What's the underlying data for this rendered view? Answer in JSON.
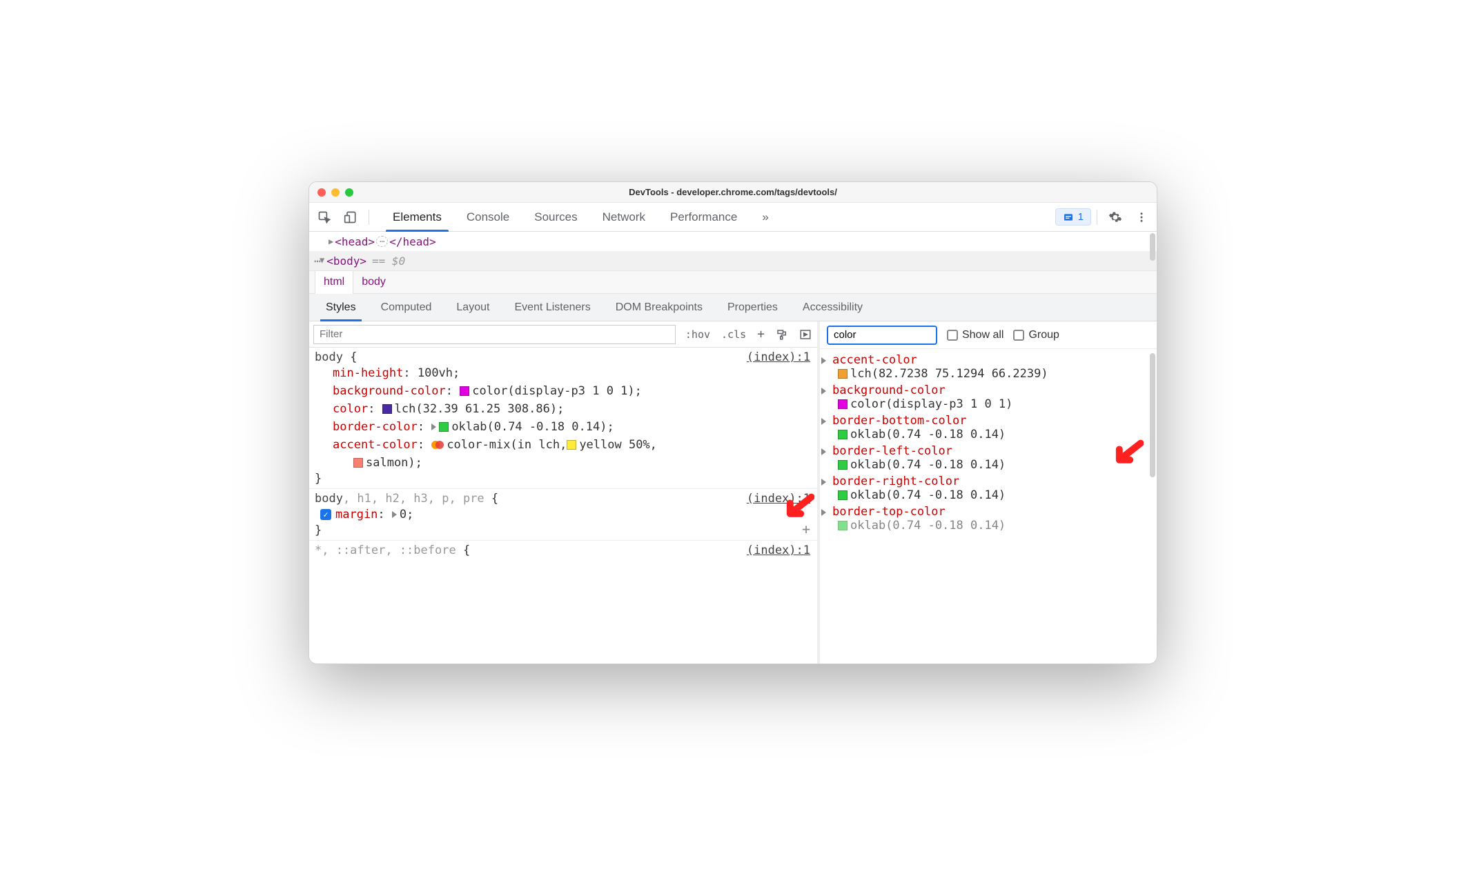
{
  "window": {
    "title": "DevTools - developer.chrome.com/tags/devtools/"
  },
  "toolbar": {
    "tabs": [
      "Elements",
      "Console",
      "Sources",
      "Network",
      "Performance"
    ],
    "more": "»",
    "issues_count": "1"
  },
  "dom": {
    "head_open": "<head>",
    "head_close": "</head>",
    "body_open": "<body>",
    "selected_hint": "== $0"
  },
  "breadcrumb": {
    "items": [
      "html",
      "body"
    ]
  },
  "subtabs": [
    "Styles",
    "Computed",
    "Layout",
    "Event Listeners",
    "DOM Breakpoints",
    "Properties",
    "Accessibility"
  ],
  "styles_toolbar": {
    "filter_placeholder": "Filter",
    "hov": ":hov",
    "cls": ".cls",
    "plus": "+"
  },
  "rules": [
    {
      "selector_main": "body",
      "selector_dim": "",
      "source": "(index):1",
      "decls": [
        {
          "prop": "min-height",
          "value": "100vh"
        },
        {
          "prop": "background-color",
          "value": "color(display-p3 1 0 1)",
          "swatch": "#e000e0"
        },
        {
          "prop": "color",
          "value": "lch(32.39 61.25 308.86)",
          "swatch": "#4a2aa0"
        },
        {
          "prop": "border-color",
          "value": "oklab(0.74 -0.18 0.14)",
          "swatch": "#2ecc40",
          "expand": true
        },
        {
          "prop": "accent-color",
          "value_prefix": "color-mix(in lch, ",
          "mix": true,
          "part1_swatch": "#ffeb3b",
          "part1_text": "yellow 50%,",
          "cont_swatch": "#fa8072",
          "cont_text": "salmon);"
        }
      ]
    },
    {
      "selector_main": "body",
      "selector_dim": ", h1, h2, h3, p, pre",
      "source": "(index):1",
      "checked": true,
      "decls": [
        {
          "prop": "margin",
          "value": "0",
          "expand": true
        }
      ],
      "add_plus": true
    },
    {
      "selector_main": "",
      "selector_dim": "*, ::after, ::before",
      "source": "(index):1",
      "decls": []
    }
  ],
  "computed": {
    "filter_value": "color",
    "show_all_label": "Show all",
    "group_label": "Group",
    "items": [
      {
        "name": "accent-color",
        "value": "lch(82.7238 75.1294 66.2239)",
        "swatch": "#f0a030"
      },
      {
        "name": "background-color",
        "value": "color(display-p3 1 0 1)",
        "swatch": "#e000e0"
      },
      {
        "name": "border-bottom-color",
        "value": "oklab(0.74 -0.18 0.14)",
        "swatch": "#2ecc40"
      },
      {
        "name": "border-left-color",
        "value": "oklab(0.74 -0.18 0.14)",
        "swatch": "#2ecc40"
      },
      {
        "name": "border-right-color",
        "value": "oklab(0.74 -0.18 0.14)",
        "swatch": "#2ecc40"
      },
      {
        "name": "border-top-color",
        "value": "oklab(0.74 -0.18 0.14)",
        "swatch": "#2ecc40",
        "cut": true
      }
    ]
  }
}
